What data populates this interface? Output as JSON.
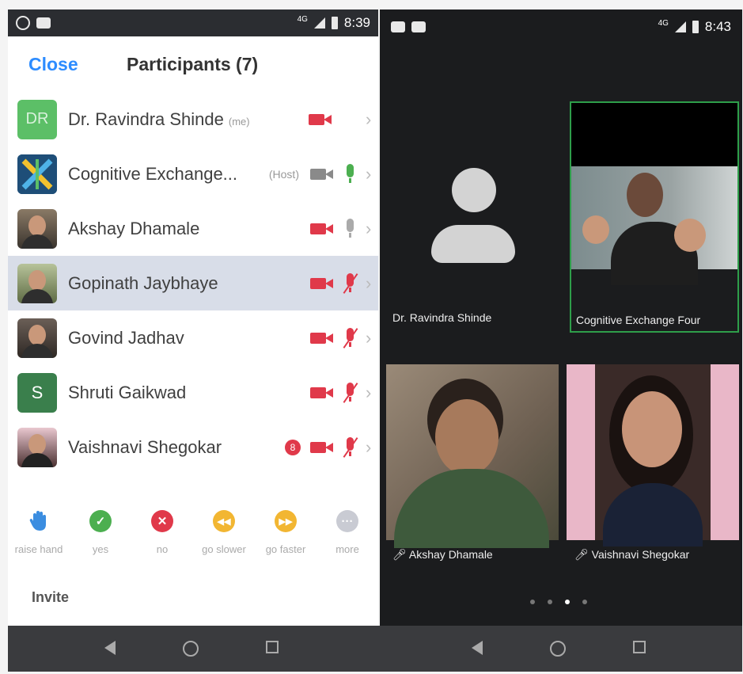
{
  "left_status": {
    "time": "8:39",
    "network": "4G"
  },
  "right_status": {
    "time": "8:43",
    "network": "4G"
  },
  "header": {
    "close_label": "Close",
    "title": "Participants (7)"
  },
  "participants": [
    {
      "name": "Dr. Ravindra Shinde",
      "tag": "(me)",
      "initials": "DR"
    },
    {
      "name": "Cognitive Exchange...",
      "tag": "(Host)"
    },
    {
      "name": "Akshay Dhamale"
    },
    {
      "name": "Gopinath Jaybhaye"
    },
    {
      "name": "Govind Jadhav"
    },
    {
      "name": "Shruti Gaikwad",
      "initials": "S"
    },
    {
      "name": "Vaishnavi Shegokar",
      "chat_badge": "8"
    }
  ],
  "reactions": [
    {
      "label": "raise hand",
      "icon": "hand-icon",
      "color": "#3b8de0"
    },
    {
      "label": "yes",
      "icon": "check-icon",
      "color": "#4caf50"
    },
    {
      "label": "no",
      "icon": "x-icon",
      "color": "#e0394a"
    },
    {
      "label": "go slower",
      "icon": "rewind-icon",
      "color": "#f2b632"
    },
    {
      "label": "go faster",
      "icon": "fast-forward-icon",
      "color": "#f2b632"
    },
    {
      "label": "more",
      "icon": "more-icon",
      "color": "#c9cbd3"
    }
  ],
  "invite_label": "Invite",
  "video_tiles": [
    {
      "name": "Dr. Ravindra Shinde"
    },
    {
      "name": "Cognitive Exchange Four"
    },
    {
      "name": "Akshay Dhamale"
    },
    {
      "name": "Vaishnavi Shegokar"
    }
  ],
  "pager": {
    "pages": 4,
    "active": 2
  },
  "colors": {
    "accent": "#2d8cff",
    "muted_red": "#e0394a",
    "active_border": "#2e9e4a"
  }
}
